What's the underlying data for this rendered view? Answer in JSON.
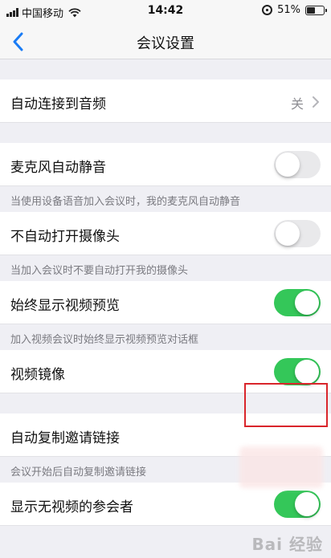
{
  "status_bar": {
    "carrier": "中国移动",
    "time": "14:42",
    "battery_text": "51%",
    "battery_level": 0.51
  },
  "nav": {
    "title": "会议设置"
  },
  "settings": [
    {
      "label": "自动连接到音频",
      "value": "关"
    },
    {
      "label": "麦克风自动静音",
      "toggle": false,
      "description": "当使用设备语音加入会议时，我的麦克风自动静音"
    },
    {
      "label": "不自动打开摄像头",
      "toggle": false,
      "description": "当加入会议时不要自动打开我的摄像头"
    },
    {
      "label": "始终显示视频预览",
      "toggle": true,
      "description": "加入视频会议时始终显示视频预览对话框"
    },
    {
      "label": "视频镜像",
      "toggle": true
    },
    {
      "label": "自动复制邀请链接",
      "description": "会议开始后自动复制邀请链接"
    },
    {
      "label": "显示无视频的参会者",
      "toggle": true
    }
  ],
  "colors": {
    "toggle_on": "#34c759",
    "toggle_off": "#e9e9eb",
    "accent": "#1a7cf5",
    "highlight": "#d9252b"
  },
  "watermark": "Bai 经验"
}
